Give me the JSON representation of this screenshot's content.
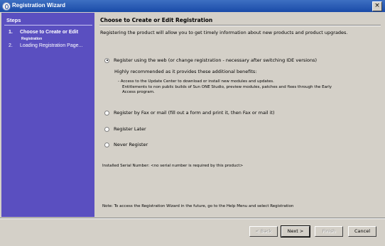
{
  "window": {
    "title": "Registration Wizard",
    "close_glyph": "×"
  },
  "steps": {
    "title": "Steps",
    "items": [
      {
        "number": "1.",
        "label": "Choose to Create or Edit",
        "sublabel": "Registration"
      },
      {
        "number": "2.",
        "label": "Loading Registration Page..."
      }
    ]
  },
  "main": {
    "title": "Choose to Create or Edit Registration",
    "intro": "Registering the product will allow you to get timely information about new products and product upgrades.",
    "options": [
      {
        "label": "Register using the web (or change registration - necessary after switching IDE versions)",
        "checked": true
      },
      {
        "label": "Register by Fax or mail (fill out a form and print it, then Fax or mail it)",
        "checked": false
      },
      {
        "label": "Register Later",
        "checked": false
      },
      {
        "label": "Never Register",
        "checked": false
      }
    ],
    "benefits_heading": "Highly recommended as it provides these additional benefits:",
    "benefits": [
      "- Access to the Update Center to download or install new modules and updates.",
      "Entitlements to non public builds of Sun ONE Studio, preview modules, patches and fixes through the Early",
      "Access program."
    ],
    "serial": "Installed Serial Number: <no serial number is required by this product>",
    "note": "Note: To access the Registration Wizard in the future, go to the Help Menu and select Registration"
  },
  "buttons": {
    "back": "< Back",
    "next": "Next >",
    "finish": "Finish",
    "cancel": "Cancel"
  }
}
